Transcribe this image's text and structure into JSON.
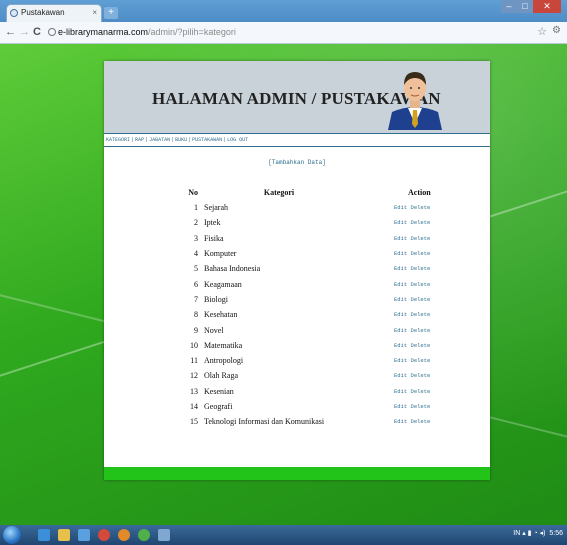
{
  "browser": {
    "tab_title": "Pustakawan",
    "tab_close": "×",
    "new_tab": "+",
    "url_host": "e-librarymanarma.com",
    "url_path": "/admin/?pilih=kategori",
    "window_controls": {
      "minimize": "–",
      "maximize": "□",
      "close": "✕"
    }
  },
  "admin": {
    "header_title": "HALAMAN ADMIN / PUSTAKAWAN",
    "menu": [
      "KATEGORI",
      "RAP",
      "JABATAN",
      "BUKU",
      "PUSTAKAWAN",
      "LOG OUT"
    ],
    "add_label": "[Tambahkan Data]",
    "table": {
      "headers": {
        "no": "No",
        "kategori": "Kategori",
        "action": "Action"
      },
      "edit_label": "Edit",
      "delete_label": "Delete",
      "rows": [
        {
          "no": "1",
          "kategori": "Sejarah"
        },
        {
          "no": "2",
          "kategori": "Iptek"
        },
        {
          "no": "3",
          "kategori": "Fisika"
        },
        {
          "no": "4",
          "kategori": "Komputer"
        },
        {
          "no": "5",
          "kategori": "Bahasa Indonesia"
        },
        {
          "no": "6",
          "kategori": "Keagamaan"
        },
        {
          "no": "7",
          "kategori": "Biologi"
        },
        {
          "no": "8",
          "kategori": "Kesehatan"
        },
        {
          "no": "9",
          "kategori": "Novel"
        },
        {
          "no": "10",
          "kategori": "Matematika"
        },
        {
          "no": "11",
          "kategori": "Antropologi"
        },
        {
          "no": "12",
          "kategori": "Olah Raga"
        },
        {
          "no": "13",
          "kategori": "Kesenian"
        },
        {
          "no": "14",
          "kategori": "Geografi"
        },
        {
          "no": "15",
          "kategori": "Teknologi Informasi dan Komunikasi"
        }
      ]
    }
  },
  "taskbar": {
    "clock": "5:56"
  },
  "colors": {
    "accent_link": "#2f6f8f",
    "footer_green": "#22c41a",
    "banner_bg": "#c8d2d8"
  }
}
